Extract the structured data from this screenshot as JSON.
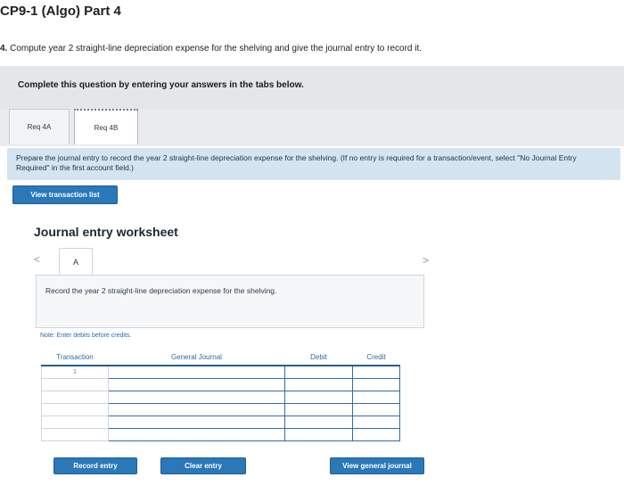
{
  "header": {
    "title": "CP9-1 (Algo) Part 4",
    "question_number": "4.",
    "question_text": " Compute year 2 straight-line depreciation expense for the shelving and give the journal entry to record it."
  },
  "complete_bar": {
    "text": "Complete this question by entering your answers in the tabs below."
  },
  "tabs": [
    {
      "label": "Req 4A"
    },
    {
      "label": "Req 4B"
    }
  ],
  "instruction": {
    "text": "Prepare the journal entry to record the year 2 straight-line depreciation expense for the shelving. (If no entry is required for a transaction/event, select \"No Journal Entry Required\" in the first account field.)"
  },
  "buttons": {
    "view_transaction_list": "View transaction list",
    "record_entry": "Record entry",
    "clear_entry": "Clear entry",
    "view_general_journal": "View general journal"
  },
  "worksheet": {
    "title": "Journal entry worksheet",
    "nav_prev": "<",
    "nav_next": ">",
    "entry_tab": "A",
    "description": "Record the year 2 straight-line depreciation expense for the shelving.",
    "note": "Note: Enter debits before credits."
  },
  "table": {
    "headers": [
      "Transaction",
      "General Journal",
      "Debit",
      "Credit"
    ],
    "first_transaction": "1"
  },
  "colors": {
    "button_blue": "#2a78b8",
    "instruction_bg": "#d4e5f1",
    "header_underline": "#1f5f99"
  }
}
